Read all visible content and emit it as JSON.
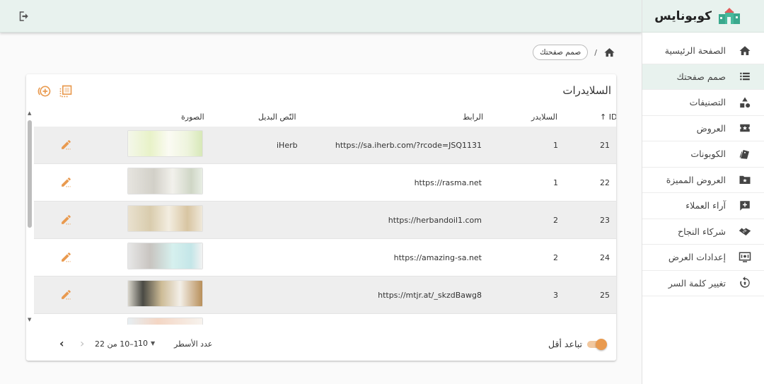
{
  "brand": {
    "name": "كوبونايس",
    "logo_icon": "house-logo-icon"
  },
  "topbar": {
    "logout_icon": "logout-icon"
  },
  "sidebar": {
    "active_index": 1,
    "items": [
      {
        "label": "الصفحة الرئيسية",
        "icon": "home-icon"
      },
      {
        "label": "صمم صفحتك",
        "icon": "list-icon"
      },
      {
        "label": "التصنيفات",
        "icon": "category-icon"
      },
      {
        "label": "العروض",
        "icon": "offers-icon"
      },
      {
        "label": "الكوبونات",
        "icon": "coupons-icon"
      },
      {
        "label": "العروض المميزة",
        "icon": "featured-folder-icon"
      },
      {
        "label": "آراء العملاء",
        "icon": "review-icon"
      },
      {
        "label": "شركاء النجاح",
        "icon": "handshake-icon"
      },
      {
        "label": "إعدادات العرض",
        "icon": "display-settings-icon"
      },
      {
        "label": "تغيير كلمة السر",
        "icon": "password-reset-icon"
      }
    ]
  },
  "breadcrumb": {
    "home_icon": "home-icon",
    "separator": "/",
    "current": "صمم صفحتك"
  },
  "table": {
    "title": "السلايدرات",
    "toolbar": {
      "add_icon": "add-circle-icon",
      "select_icon": "select-all-icon"
    },
    "columns": {
      "id": "ID",
      "slider": "السلايدر",
      "link": "الرابط",
      "alt": "النّص البديل",
      "image": "الصورة"
    },
    "sort_icon": "arrow-up-icon",
    "rows": [
      {
        "id": "21",
        "slider": "1",
        "link": "https://sa.iherb.com/?rcode=JSQ1131",
        "alt": "iHerb",
        "thumb": "iherb"
      },
      {
        "id": "22",
        "slider": "1",
        "link": "https://rasma.net",
        "alt": "",
        "thumb": "rasma"
      },
      {
        "id": "23",
        "slider": "2",
        "link": "https://herbandoil1.com",
        "alt": "",
        "thumb": "herb"
      },
      {
        "id": "24",
        "slider": "2",
        "link": "https://amazing-sa.net",
        "alt": "",
        "thumb": "amazing"
      },
      {
        "id": "25",
        "slider": "3",
        "link": "https://mtjr.at/_skzdBawg8",
        "alt": "",
        "thumb": "mtjr"
      },
      {
        "id": "",
        "slider": "",
        "link": "",
        "alt": "",
        "thumb": "partial"
      }
    ],
    "edit_icon": "edit-pencil-icon",
    "footer": {
      "dense_label": "تباعد أقل",
      "dense_on": true,
      "rows_per_page_label": "عدد الأسطر",
      "rows_per_page": "10",
      "range": "1–10 من 22",
      "prev_icon": "chevron-left-icon",
      "next_icon": "chevron-right-icon"
    }
  },
  "colors": {
    "accent": "#e99a4f",
    "header_bg": "#e8f2ee",
    "row_alt": "#eeeeee"
  }
}
